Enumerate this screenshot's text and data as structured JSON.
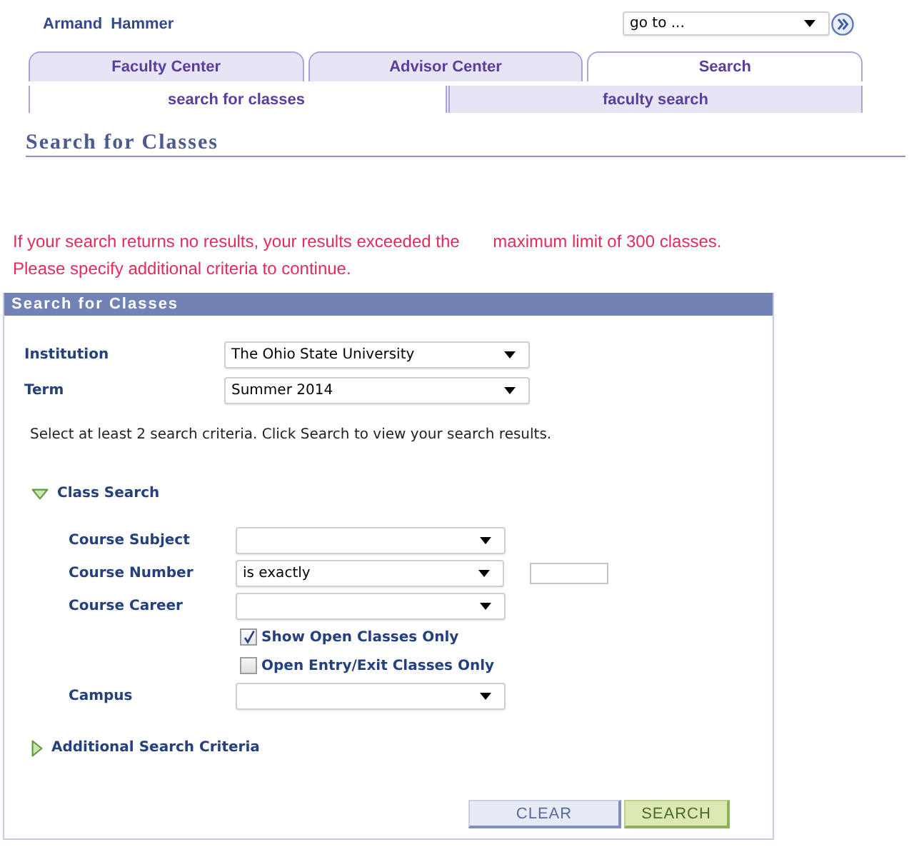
{
  "user": {
    "name": "Armand  Hammer"
  },
  "goto": {
    "value": "go to ..."
  },
  "tabs": [
    {
      "label": "Faculty Center",
      "selected": false
    },
    {
      "label": "Advisor Center",
      "selected": false
    },
    {
      "label": "Search",
      "selected": true
    }
  ],
  "subtabs": [
    {
      "label": "search for classes",
      "selected": true
    },
    {
      "label": "faculty search",
      "selected": false
    }
  ],
  "page_title": "Search for Classes",
  "message": [
    "If your search returns no results, your results exceeded the       maximum limit of 300 classes.",
    "Please specify additional criteria to continue."
  ],
  "panel": {
    "title": "Search for Classes",
    "fields": [
      {
        "label": "Institution",
        "value": "The Ohio State University"
      },
      {
        "label": "Term",
        "value": "Summer 2014"
      }
    ],
    "instructions": "Select at least 2 search criteria. Click Search to view your search results.",
    "sections": [
      {
        "title": "Class Search",
        "expanded": true,
        "rows": [
          {
            "kind": "select",
            "label": "Course Subject"
          },
          {
            "kind": "select_input",
            "label": "Course Number",
            "value": "is exactly"
          },
          {
            "kind": "select",
            "label": "Course Career"
          },
          {
            "kind": "checkbox",
            "label": "Show Open Classes Only",
            "checked": true
          },
          {
            "kind": "checkbox",
            "label": "Open Entry/Exit Classes Only",
            "checked": false
          },
          {
            "kind": "select",
            "label": "Campus"
          }
        ]
      },
      {
        "title": "Additional Search Criteria",
        "expanded": false
      }
    ],
    "buttons": [
      {
        "kind": "clear",
        "label": "CLEAR"
      },
      {
        "kind": "search",
        "label": "SEARCH"
      }
    ]
  }
}
